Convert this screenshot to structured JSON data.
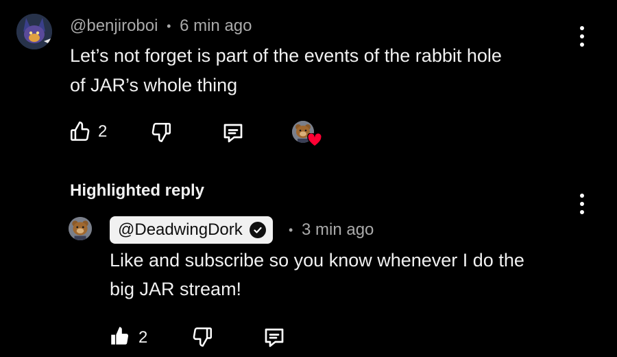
{
  "comment": {
    "handle": "@benjiroboi",
    "separator": "•",
    "time": "6 min ago",
    "text_line1": "Let’s not forget is part of the events of the rabbit hole",
    "text_line2": "of JAR’s whole thing",
    "like_count": "2",
    "icons": [
      "thumbs-up-outline-icon",
      "thumbs-down-outline-icon",
      "reply-comment-icon",
      "creator-heart-icon",
      "more-vert-icon"
    ]
  },
  "highlighted_reply": {
    "section_label": "Highlighted reply",
    "handle": "@DeadwingDork",
    "separator": "•",
    "time": "3 min ago",
    "text_line1": "Like and subscribe so you know whenever I do the",
    "text_line2": "big JAR stream!",
    "like_count": "2",
    "icons": [
      "thumbs-up-filled-icon",
      "thumbs-down-outline-icon",
      "reply-comment-icon",
      "verified-check-icon",
      "more-vert-icon"
    ]
  },
  "colors": {
    "background": "#000000",
    "text": "#f1f1f1",
    "muted": "#aaaaaa",
    "heart": "#ff0033",
    "chip": "#f1f1f1"
  }
}
